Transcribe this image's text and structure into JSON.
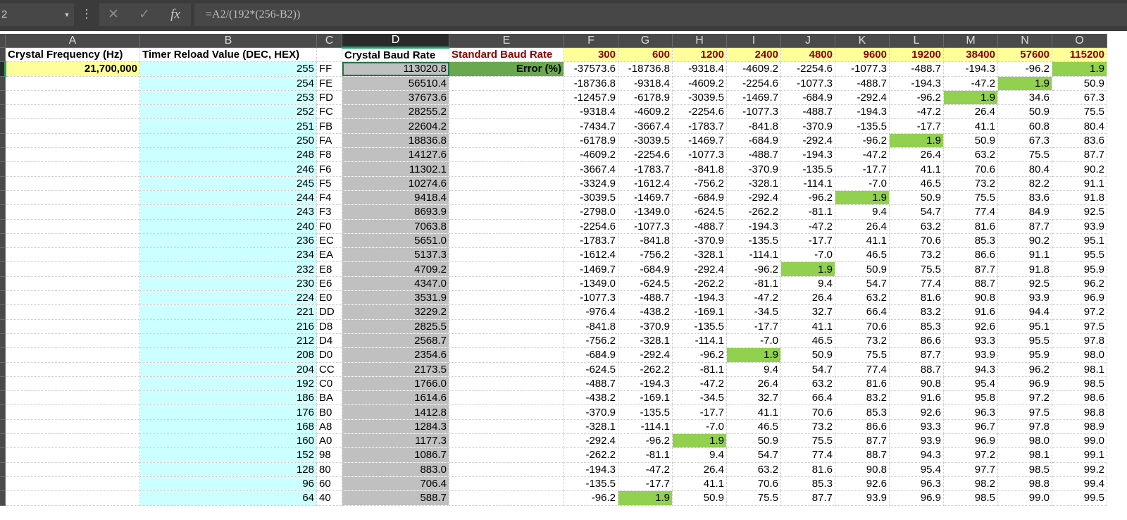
{
  "formula_bar": {
    "name_box": "2",
    "formula": "=A2/(192*(256-B2))",
    "fx_label": "fx",
    "cancel_glyph": "✕",
    "enter_glyph": "✓",
    "more_glyph": "⋮"
  },
  "columns": [
    "A",
    "B",
    "C",
    "D",
    "E",
    "F",
    "G",
    "H",
    "I",
    "J",
    "K",
    "L",
    "M",
    "N",
    "O"
  ],
  "selected_column": "D",
  "header_row": {
    "A": "Crystal Frequency (Hz)",
    "B": "Timer Reload Value (DEC, HEX)",
    "D": "Crystal Baud Rate",
    "E": "Standard Baud Rate",
    "baud_rates": [
      "300",
      "600",
      "1200",
      "2400",
      "4800",
      "9600",
      "19200",
      "38400",
      "57600",
      "115200"
    ]
  },
  "crystal_frequency": "21,700,000",
  "error_label": "Error (%)",
  "colors": {
    "highlight": "#92d050",
    "error_label_bg": "#6aa84f",
    "yellow": "#ffff99",
    "cyan": "#ccffff",
    "gray": "#c0c0c0",
    "accent": "#21a366"
  },
  "rows": [
    {
      "reload": "255",
      "hex": "FF",
      "crystal": "113020.8",
      "errors": [
        "-37573.6",
        "-18736.8",
        "-9318.4",
        "-4609.2",
        "-2254.6",
        "-1077.3",
        "-488.7",
        "-194.3",
        "-96.2",
        "1.9"
      ],
      "hl": 9
    },
    {
      "reload": "254",
      "hex": "FE",
      "crystal": "56510.4",
      "errors": [
        "-18736.8",
        "-9318.4",
        "-4609.2",
        "-2254.6",
        "-1077.3",
        "-488.7",
        "-194.3",
        "-47.2",
        "1.9",
        "50.9"
      ],
      "hl": 8
    },
    {
      "reload": "253",
      "hex": "FD",
      "crystal": "37673.6",
      "errors": [
        "-12457.9",
        "-6178.9",
        "-3039.5",
        "-1469.7",
        "-684.9",
        "-292.4",
        "-96.2",
        "1.9",
        "34.6",
        "67.3"
      ],
      "hl": 7
    },
    {
      "reload": "252",
      "hex": "FC",
      "crystal": "28255.2",
      "errors": [
        "-9318.4",
        "-4609.2",
        "-2254.6",
        "-1077.3",
        "-488.7",
        "-194.3",
        "-47.2",
        "26.4",
        "50.9",
        "75.5"
      ],
      "hl": -1
    },
    {
      "reload": "251",
      "hex": "FB",
      "crystal": "22604.2",
      "errors": [
        "-7434.7",
        "-3667.4",
        "-1783.7",
        "-841.8",
        "-370.9",
        "-135.5",
        "-17.7",
        "41.1",
        "60.8",
        "80.4"
      ],
      "hl": -1
    },
    {
      "reload": "250",
      "hex": "FA",
      "crystal": "18836.8",
      "errors": [
        "-6178.9",
        "-3039.5",
        "-1469.7",
        "-684.9",
        "-292.4",
        "-96.2",
        "1.9",
        "50.9",
        "67.3",
        "83.6"
      ],
      "hl": 6
    },
    {
      "reload": "248",
      "hex": "F8",
      "crystal": "14127.6",
      "errors": [
        "-4609.2",
        "-2254.6",
        "-1077.3",
        "-488.7",
        "-194.3",
        "-47.2",
        "26.4",
        "63.2",
        "75.5",
        "87.7"
      ],
      "hl": -1
    },
    {
      "reload": "246",
      "hex": "F6",
      "crystal": "11302.1",
      "errors": [
        "-3667.4",
        "-1783.7",
        "-841.8",
        "-370.9",
        "-135.5",
        "-17.7",
        "41.1",
        "70.6",
        "80.4",
        "90.2"
      ],
      "hl": -1
    },
    {
      "reload": "245",
      "hex": "F5",
      "crystal": "10274.6",
      "errors": [
        "-3324.9",
        "-1612.4",
        "-756.2",
        "-328.1",
        "-114.1",
        "-7.0",
        "46.5",
        "73.2",
        "82.2",
        "91.1"
      ],
      "hl": -1
    },
    {
      "reload": "244",
      "hex": "F4",
      "crystal": "9418.4",
      "errors": [
        "-3039.5",
        "-1469.7",
        "-684.9",
        "-292.4",
        "-96.2",
        "1.9",
        "50.9",
        "75.5",
        "83.6",
        "91.8"
      ],
      "hl": 5
    },
    {
      "reload": "243",
      "hex": "F3",
      "crystal": "8693.9",
      "errors": [
        "-2798.0",
        "-1349.0",
        "-624.5",
        "-262.2",
        "-81.1",
        "9.4",
        "54.7",
        "77.4",
        "84.9",
        "92.5"
      ],
      "hl": -1
    },
    {
      "reload": "240",
      "hex": "F0",
      "crystal": "7063.8",
      "errors": [
        "-2254.6",
        "-1077.3",
        "-488.7",
        "-194.3",
        "-47.2",
        "26.4",
        "63.2",
        "81.6",
        "87.7",
        "93.9"
      ],
      "hl": -1
    },
    {
      "reload": "236",
      "hex": "EC",
      "crystal": "5651.0",
      "errors": [
        "-1783.7",
        "-841.8",
        "-370.9",
        "-135.5",
        "-17.7",
        "41.1",
        "70.6",
        "85.3",
        "90.2",
        "95.1"
      ],
      "hl": -1
    },
    {
      "reload": "234",
      "hex": "EA",
      "crystal": "5137.3",
      "errors": [
        "-1612.4",
        "-756.2",
        "-328.1",
        "-114.1",
        "-7.0",
        "46.5",
        "73.2",
        "86.6",
        "91.1",
        "95.5"
      ],
      "hl": -1
    },
    {
      "reload": "232",
      "hex": "E8",
      "crystal": "4709.2",
      "errors": [
        "-1469.7",
        "-684.9",
        "-292.4",
        "-96.2",
        "1.9",
        "50.9",
        "75.5",
        "87.7",
        "91.8",
        "95.9"
      ],
      "hl": 4
    },
    {
      "reload": "230",
      "hex": "E6",
      "crystal": "4347.0",
      "errors": [
        "-1349.0",
        "-624.5",
        "-262.2",
        "-81.1",
        "9.4",
        "54.7",
        "77.4",
        "88.7",
        "92.5",
        "96.2"
      ],
      "hl": -1
    },
    {
      "reload": "224",
      "hex": "E0",
      "crystal": "3531.9",
      "errors": [
        "-1077.3",
        "-488.7",
        "-194.3",
        "-47.2",
        "26.4",
        "63.2",
        "81.6",
        "90.8",
        "93.9",
        "96.9"
      ],
      "hl": -1
    },
    {
      "reload": "221",
      "hex": "DD",
      "crystal": "3229.2",
      "errors": [
        "-976.4",
        "-438.2",
        "-169.1",
        "-34.5",
        "32.7",
        "66.4",
        "83.2",
        "91.6",
        "94.4",
        "97.2"
      ],
      "hl": -1
    },
    {
      "reload": "216",
      "hex": "D8",
      "crystal": "2825.5",
      "errors": [
        "-841.8",
        "-370.9",
        "-135.5",
        "-17.7",
        "41.1",
        "70.6",
        "85.3",
        "92.6",
        "95.1",
        "97.5"
      ],
      "hl": -1
    },
    {
      "reload": "212",
      "hex": "D4",
      "crystal": "2568.7",
      "errors": [
        "-756.2",
        "-328.1",
        "-114.1",
        "-7.0",
        "46.5",
        "73.2",
        "86.6",
        "93.3",
        "95.5",
        "97.8"
      ],
      "hl": -1
    },
    {
      "reload": "208",
      "hex": "D0",
      "crystal": "2354.6",
      "errors": [
        "-684.9",
        "-292.4",
        "-96.2",
        "1.9",
        "50.9",
        "75.5",
        "87.7",
        "93.9",
        "95.9",
        "98.0"
      ],
      "hl": 3
    },
    {
      "reload": "204",
      "hex": "CC",
      "crystal": "2173.5",
      "errors": [
        "-624.5",
        "-262.2",
        "-81.1",
        "9.4",
        "54.7",
        "77.4",
        "88.7",
        "94.3",
        "96.2",
        "98.1"
      ],
      "hl": -1
    },
    {
      "reload": "192",
      "hex": "C0",
      "crystal": "1766.0",
      "errors": [
        "-488.7",
        "-194.3",
        "-47.2",
        "26.4",
        "63.2",
        "81.6",
        "90.8",
        "95.4",
        "96.9",
        "98.5"
      ],
      "hl": -1
    },
    {
      "reload": "186",
      "hex": "BA",
      "crystal": "1614.6",
      "errors": [
        "-438.2",
        "-169.1",
        "-34.5",
        "32.7",
        "66.4",
        "83.2",
        "91.6",
        "95.8",
        "97.2",
        "98.6"
      ],
      "hl": -1
    },
    {
      "reload": "176",
      "hex": "B0",
      "crystal": "1412.8",
      "errors": [
        "-370.9",
        "-135.5",
        "-17.7",
        "41.1",
        "70.6",
        "85.3",
        "92.6",
        "96.3",
        "97.5",
        "98.8"
      ],
      "hl": -1
    },
    {
      "reload": "168",
      "hex": "A8",
      "crystal": "1284.3",
      "errors": [
        "-328.1",
        "-114.1",
        "-7.0",
        "46.5",
        "73.2",
        "86.6",
        "93.3",
        "96.7",
        "97.8",
        "98.9"
      ],
      "hl": -1
    },
    {
      "reload": "160",
      "hex": "A0",
      "crystal": "1177.3",
      "errors": [
        "-292.4",
        "-96.2",
        "1.9",
        "50.9",
        "75.5",
        "87.7",
        "93.9",
        "96.9",
        "98.0",
        "99.0"
      ],
      "hl": 2
    },
    {
      "reload": "152",
      "hex": "98",
      "crystal": "1086.7",
      "errors": [
        "-262.2",
        "-81.1",
        "9.4",
        "54.7",
        "77.4",
        "88.7",
        "94.3",
        "97.2",
        "98.1",
        "99.1"
      ],
      "hl": -1
    },
    {
      "reload": "128",
      "hex": "80",
      "crystal": "883.0",
      "errors": [
        "-194.3",
        "-47.2",
        "26.4",
        "63.2",
        "81.6",
        "90.8",
        "95.4",
        "97.7",
        "98.5",
        "99.2"
      ],
      "hl": -1
    },
    {
      "reload": "96",
      "hex": "60",
      "crystal": "706.4",
      "errors": [
        "-135.5",
        "-17.7",
        "41.1",
        "70.6",
        "85.3",
        "92.6",
        "96.3",
        "98.2",
        "98.8",
        "99.4"
      ],
      "hl": -1
    },
    {
      "reload": "64",
      "hex": "40",
      "crystal": "588.7",
      "errors": [
        "-96.2",
        "1.9",
        "50.9",
        "75.5",
        "87.7",
        "93.9",
        "96.9",
        "98.5",
        "99.0",
        "99.5"
      ],
      "hl": 1
    }
  ]
}
